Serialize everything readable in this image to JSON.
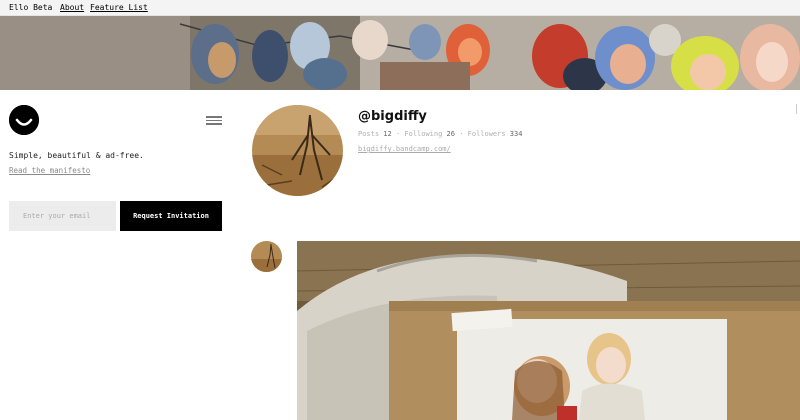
{
  "topnav": {
    "brand": "Ello Beta",
    "about": "About",
    "features": "Feature List"
  },
  "sidebar": {
    "tagline": "Simple, beautiful & ad-free.",
    "manifesto_link": "Read the manifesto",
    "email_placeholder": "Enter your email",
    "invite_button": "Request Invitation"
  },
  "profile": {
    "username": "@bigdiffy",
    "posts_label": "Posts",
    "posts_count": "12",
    "following_label": "Following",
    "following_count": "26",
    "followers_label": "Followers",
    "followers_count": "334",
    "separator": "·",
    "website": "bigdiffy.bandcamp.com/"
  },
  "icons": {
    "logo": "ello-smile-logo",
    "menu": "hamburger-menu-icon"
  },
  "colors": {
    "button_bg": "#000000",
    "input_bg": "#ececec",
    "muted_text": "#aaaaaa"
  }
}
